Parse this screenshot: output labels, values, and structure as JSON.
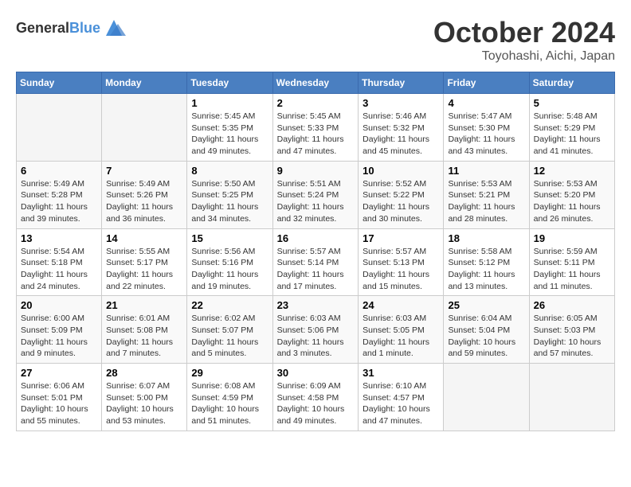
{
  "header": {
    "logo_general": "General",
    "logo_blue": "Blue",
    "month": "October 2024",
    "location": "Toyohashi, Aichi, Japan"
  },
  "weekdays": [
    "Sunday",
    "Monday",
    "Tuesday",
    "Wednesday",
    "Thursday",
    "Friday",
    "Saturday"
  ],
  "weeks": [
    [
      {
        "day": "",
        "sunrise": "",
        "sunset": "",
        "daylight": "",
        "empty": true
      },
      {
        "day": "",
        "sunrise": "",
        "sunset": "",
        "daylight": "",
        "empty": true
      },
      {
        "day": "1",
        "sunrise": "Sunrise: 5:45 AM",
        "sunset": "Sunset: 5:35 PM",
        "daylight": "Daylight: 11 hours and 49 minutes."
      },
      {
        "day": "2",
        "sunrise": "Sunrise: 5:45 AM",
        "sunset": "Sunset: 5:33 PM",
        "daylight": "Daylight: 11 hours and 47 minutes."
      },
      {
        "day": "3",
        "sunrise": "Sunrise: 5:46 AM",
        "sunset": "Sunset: 5:32 PM",
        "daylight": "Daylight: 11 hours and 45 minutes."
      },
      {
        "day": "4",
        "sunrise": "Sunrise: 5:47 AM",
        "sunset": "Sunset: 5:30 PM",
        "daylight": "Daylight: 11 hours and 43 minutes."
      },
      {
        "day": "5",
        "sunrise": "Sunrise: 5:48 AM",
        "sunset": "Sunset: 5:29 PM",
        "daylight": "Daylight: 11 hours and 41 minutes."
      }
    ],
    [
      {
        "day": "6",
        "sunrise": "Sunrise: 5:49 AM",
        "sunset": "Sunset: 5:28 PM",
        "daylight": "Daylight: 11 hours and 39 minutes."
      },
      {
        "day": "7",
        "sunrise": "Sunrise: 5:49 AM",
        "sunset": "Sunset: 5:26 PM",
        "daylight": "Daylight: 11 hours and 36 minutes."
      },
      {
        "day": "8",
        "sunrise": "Sunrise: 5:50 AM",
        "sunset": "Sunset: 5:25 PM",
        "daylight": "Daylight: 11 hours and 34 minutes."
      },
      {
        "day": "9",
        "sunrise": "Sunrise: 5:51 AM",
        "sunset": "Sunset: 5:24 PM",
        "daylight": "Daylight: 11 hours and 32 minutes."
      },
      {
        "day": "10",
        "sunrise": "Sunrise: 5:52 AM",
        "sunset": "Sunset: 5:22 PM",
        "daylight": "Daylight: 11 hours and 30 minutes."
      },
      {
        "day": "11",
        "sunrise": "Sunrise: 5:53 AM",
        "sunset": "Sunset: 5:21 PM",
        "daylight": "Daylight: 11 hours and 28 minutes."
      },
      {
        "day": "12",
        "sunrise": "Sunrise: 5:53 AM",
        "sunset": "Sunset: 5:20 PM",
        "daylight": "Daylight: 11 hours and 26 minutes."
      }
    ],
    [
      {
        "day": "13",
        "sunrise": "Sunrise: 5:54 AM",
        "sunset": "Sunset: 5:18 PM",
        "daylight": "Daylight: 11 hours and 24 minutes."
      },
      {
        "day": "14",
        "sunrise": "Sunrise: 5:55 AM",
        "sunset": "Sunset: 5:17 PM",
        "daylight": "Daylight: 11 hours and 22 minutes."
      },
      {
        "day": "15",
        "sunrise": "Sunrise: 5:56 AM",
        "sunset": "Sunset: 5:16 PM",
        "daylight": "Daylight: 11 hours and 19 minutes."
      },
      {
        "day": "16",
        "sunrise": "Sunrise: 5:57 AM",
        "sunset": "Sunset: 5:14 PM",
        "daylight": "Daylight: 11 hours and 17 minutes."
      },
      {
        "day": "17",
        "sunrise": "Sunrise: 5:57 AM",
        "sunset": "Sunset: 5:13 PM",
        "daylight": "Daylight: 11 hours and 15 minutes."
      },
      {
        "day": "18",
        "sunrise": "Sunrise: 5:58 AM",
        "sunset": "Sunset: 5:12 PM",
        "daylight": "Daylight: 11 hours and 13 minutes."
      },
      {
        "day": "19",
        "sunrise": "Sunrise: 5:59 AM",
        "sunset": "Sunset: 5:11 PM",
        "daylight": "Daylight: 11 hours and 11 minutes."
      }
    ],
    [
      {
        "day": "20",
        "sunrise": "Sunrise: 6:00 AM",
        "sunset": "Sunset: 5:09 PM",
        "daylight": "Daylight: 11 hours and 9 minutes."
      },
      {
        "day": "21",
        "sunrise": "Sunrise: 6:01 AM",
        "sunset": "Sunset: 5:08 PM",
        "daylight": "Daylight: 11 hours and 7 minutes."
      },
      {
        "day": "22",
        "sunrise": "Sunrise: 6:02 AM",
        "sunset": "Sunset: 5:07 PM",
        "daylight": "Daylight: 11 hours and 5 minutes."
      },
      {
        "day": "23",
        "sunrise": "Sunrise: 6:03 AM",
        "sunset": "Sunset: 5:06 PM",
        "daylight": "Daylight: 11 hours and 3 minutes."
      },
      {
        "day": "24",
        "sunrise": "Sunrise: 6:03 AM",
        "sunset": "Sunset: 5:05 PM",
        "daylight": "Daylight: 11 hours and 1 minute."
      },
      {
        "day": "25",
        "sunrise": "Sunrise: 6:04 AM",
        "sunset": "Sunset: 5:04 PM",
        "daylight": "Daylight: 10 hours and 59 minutes."
      },
      {
        "day": "26",
        "sunrise": "Sunrise: 6:05 AM",
        "sunset": "Sunset: 5:03 PM",
        "daylight": "Daylight: 10 hours and 57 minutes."
      }
    ],
    [
      {
        "day": "27",
        "sunrise": "Sunrise: 6:06 AM",
        "sunset": "Sunset: 5:01 PM",
        "daylight": "Daylight: 10 hours and 55 minutes."
      },
      {
        "day": "28",
        "sunrise": "Sunrise: 6:07 AM",
        "sunset": "Sunset: 5:00 PM",
        "daylight": "Daylight: 10 hours and 53 minutes."
      },
      {
        "day": "29",
        "sunrise": "Sunrise: 6:08 AM",
        "sunset": "Sunset: 4:59 PM",
        "daylight": "Daylight: 10 hours and 51 minutes."
      },
      {
        "day": "30",
        "sunrise": "Sunrise: 6:09 AM",
        "sunset": "Sunset: 4:58 PM",
        "daylight": "Daylight: 10 hours and 49 minutes."
      },
      {
        "day": "31",
        "sunrise": "Sunrise: 6:10 AM",
        "sunset": "Sunset: 4:57 PM",
        "daylight": "Daylight: 10 hours and 47 minutes."
      },
      {
        "day": "",
        "sunrise": "",
        "sunset": "",
        "daylight": "",
        "empty": true
      },
      {
        "day": "",
        "sunrise": "",
        "sunset": "",
        "daylight": "",
        "empty": true
      }
    ]
  ]
}
